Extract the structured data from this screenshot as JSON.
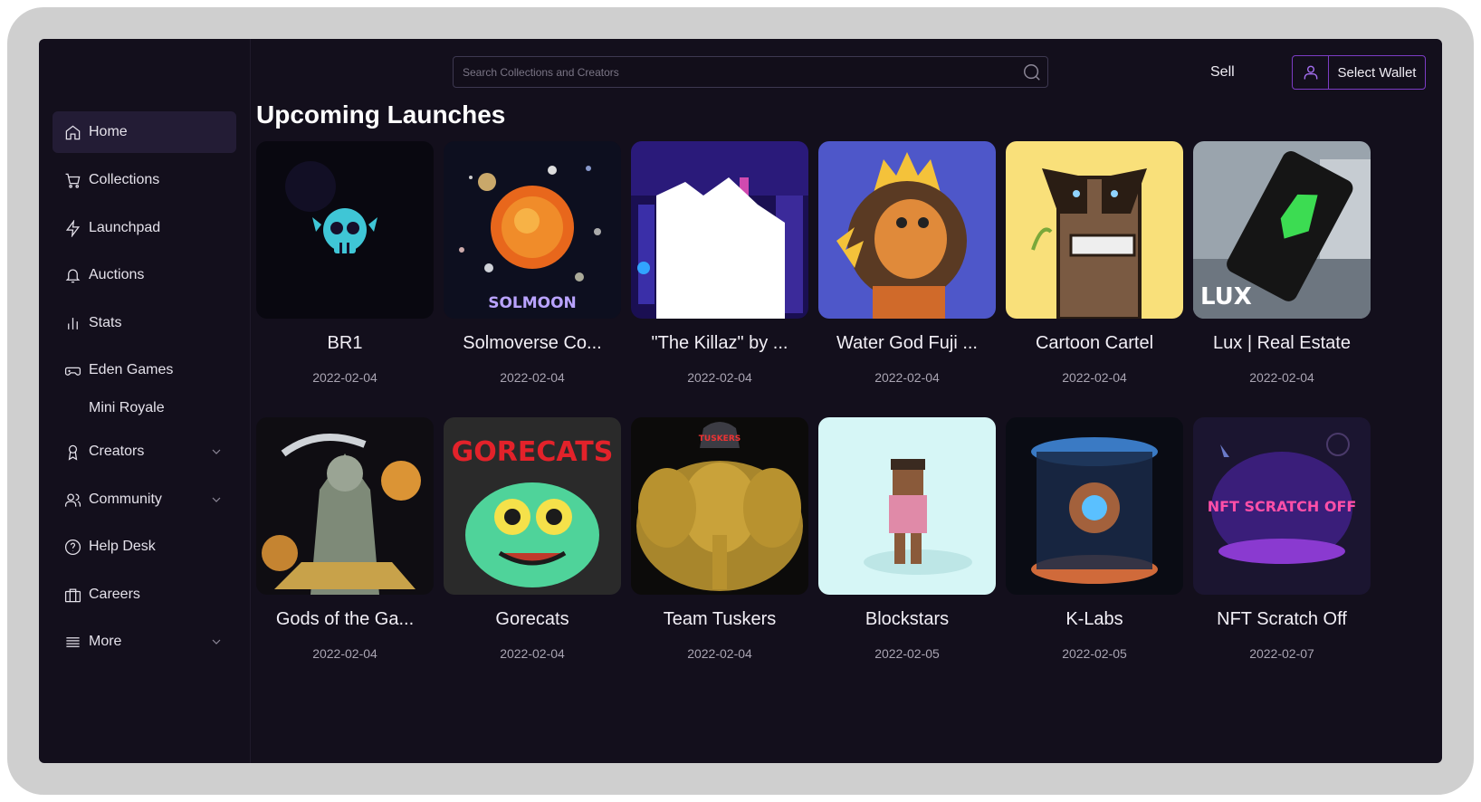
{
  "sidebar": {
    "items": [
      {
        "label": "Home",
        "icon": "home-icon"
      },
      {
        "label": "Collections",
        "icon": "cart-icon"
      },
      {
        "label": "Launchpad",
        "icon": "lightning-icon"
      },
      {
        "label": "Auctions",
        "icon": "bell-icon"
      },
      {
        "label": "Stats",
        "icon": "bar-chart-icon"
      },
      {
        "label": "Eden Games",
        "icon": "gamepad-icon"
      },
      {
        "label": "Mini Royale"
      },
      {
        "label": "Creators",
        "icon": "award-icon"
      },
      {
        "label": "Community",
        "icon": "users-icon"
      },
      {
        "label": "Help Desk",
        "icon": "help-circle-icon"
      },
      {
        "label": "Careers",
        "icon": "briefcase-icon"
      },
      {
        "label": "More",
        "icon": "menu-icon"
      }
    ]
  },
  "header": {
    "search_placeholder": "Search Collections and Creators",
    "sell_label": "Sell",
    "wallet_label": "Select Wallet"
  },
  "main": {
    "title": "Upcoming Launches",
    "cards": [
      {
        "name": "BR1",
        "date": "2022-02-04"
      },
      {
        "name": "Solmoverse Co...",
        "date": "2022-02-04",
        "art_text": "SOLMOON"
      },
      {
        "name": "\"The Killaz\" by ...",
        "date": "2022-02-04"
      },
      {
        "name": "Water God Fuji ...",
        "date": "2022-02-04"
      },
      {
        "name": "Cartoon Cartel",
        "date": "2022-02-04"
      },
      {
        "name": "Lux | Real Estate",
        "date": "2022-02-04",
        "art_text": "LUX"
      },
      {
        "name": "Gods of the Ga...",
        "date": "2022-02-04"
      },
      {
        "name": "Gorecats",
        "date": "2022-02-04",
        "art_text": "GORECATS"
      },
      {
        "name": "Team Tuskers",
        "date": "2022-02-04",
        "art_text": "TUSKERS"
      },
      {
        "name": "Blockstars",
        "date": "2022-02-05"
      },
      {
        "name": "K-Labs",
        "date": "2022-02-05"
      },
      {
        "name": "NFT Scratch Off",
        "date": "2022-02-07",
        "art_text": "NFT SCRATCH OFF"
      }
    ]
  },
  "colors": {
    "background": "#130f1c",
    "accent": "#7c3cc4",
    "active_nav": "#231c35"
  }
}
